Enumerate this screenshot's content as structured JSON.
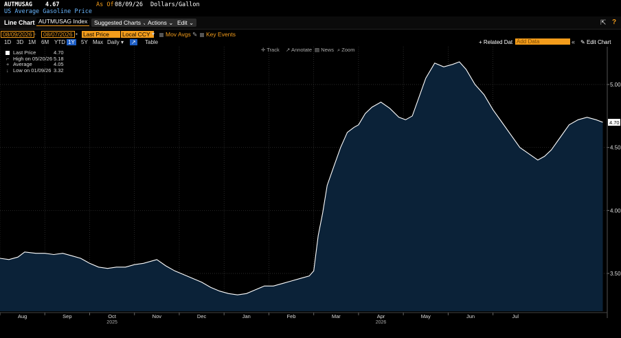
{
  "header": {
    "ticker": "AUTMUSAG",
    "price": "4.67",
    "asof_label": "As Of",
    "asof_date": "08/09/26",
    "units": "Dollars/Gallon",
    "name": "US Average Gasoline Price"
  },
  "toolbar": {
    "chart_type": "Line Chart",
    "security": "AUTMUSAG Index",
    "suggested": "Suggested Charts",
    "actions": "Actions",
    "edit": "Edit"
  },
  "controls": {
    "start_date": "08/09/2026",
    "end_date": "08/07/2026",
    "field": "Last Price",
    "currency": "Local CCY",
    "mov_avgs": "Mov Avgs",
    "key_events": "Key Events",
    "ranges": [
      "1D",
      "3D",
      "1M",
      "6M",
      "YTD",
      "1Y",
      "5Y",
      "Max"
    ],
    "selected_range": "1Y",
    "frequency": "Daily",
    "table": "Table",
    "related": "+ Related Dat",
    "add_data": "Add Data",
    "edit_chart": "Edit Chart"
  },
  "tools": {
    "track": "Track",
    "annotate": "Annotate",
    "news": "News",
    "zoom": "Zoom"
  },
  "legend": [
    {
      "label": "Last Price",
      "value": "4.70"
    },
    {
      "label": "High on 05/20/26",
      "value": "5.18"
    },
    {
      "label": "Average",
      "value": "4.05"
    },
    {
      "label": "Low on 01/09/26",
      "value": "3.32"
    }
  ],
  "chart_data": {
    "type": "area",
    "title": "US Average Gasoline Price",
    "ylabel": "Dollars/Gallon",
    "ylim": [
      3.2,
      5.3
    ],
    "yticks": [
      3.5,
      4.0,
      4.5,
      5.0
    ],
    "ytick_labels": [
      "3.50",
      "4.00",
      "4.50",
      "5.00"
    ],
    "last_value_label": "4.70",
    "months": [
      "Aug",
      "Sep",
      "Oct",
      "Nov",
      "Dec",
      "Jan",
      "Feb",
      "Mar",
      "Apr",
      "May",
      "Jun",
      "Jul"
    ],
    "year_markers": [
      "2025",
      "2026"
    ],
    "x_unit": "months since start of Aug 2025",
    "series": [
      {
        "name": "Last Price",
        "color": "#ffffff",
        "fill": "#0b2238",
        "points": [
          [
            0.0,
            3.62
          ],
          [
            0.2,
            3.61
          ],
          [
            0.4,
            3.63
          ],
          [
            0.55,
            3.67
          ],
          [
            0.8,
            3.66
          ],
          [
            1.0,
            3.66
          ],
          [
            1.2,
            3.65
          ],
          [
            1.4,
            3.66
          ],
          [
            1.6,
            3.64
          ],
          [
            1.8,
            3.62
          ],
          [
            2.0,
            3.58
          ],
          [
            2.2,
            3.55
          ],
          [
            2.4,
            3.54
          ],
          [
            2.6,
            3.55
          ],
          [
            2.8,
            3.55
          ],
          [
            3.0,
            3.57
          ],
          [
            3.2,
            3.58
          ],
          [
            3.4,
            3.6
          ],
          [
            3.5,
            3.61
          ],
          [
            3.7,
            3.56
          ],
          [
            3.9,
            3.52
          ],
          [
            4.1,
            3.49
          ],
          [
            4.3,
            3.46
          ],
          [
            4.5,
            3.43
          ],
          [
            4.7,
            3.39
          ],
          [
            4.9,
            3.36
          ],
          [
            5.1,
            3.34
          ],
          [
            5.3,
            3.33
          ],
          [
            5.5,
            3.34
          ],
          [
            5.7,
            3.37
          ],
          [
            5.9,
            3.4
          ],
          [
            6.1,
            3.4
          ],
          [
            6.3,
            3.42
          ],
          [
            6.5,
            3.44
          ],
          [
            6.7,
            3.46
          ],
          [
            6.9,
            3.48
          ],
          [
            7.0,
            3.52
          ],
          [
            7.1,
            3.8
          ],
          [
            7.2,
            3.98
          ],
          [
            7.3,
            4.2
          ],
          [
            7.45,
            4.35
          ],
          [
            7.6,
            4.5
          ],
          [
            7.75,
            4.62
          ],
          [
            7.9,
            4.66
          ],
          [
            8.0,
            4.68
          ],
          [
            8.15,
            4.77
          ],
          [
            8.3,
            4.82
          ],
          [
            8.5,
            4.86
          ],
          [
            8.7,
            4.81
          ],
          [
            8.9,
            4.74
          ],
          [
            9.05,
            4.72
          ],
          [
            9.2,
            4.75
          ],
          [
            9.35,
            4.9
          ],
          [
            9.5,
            5.05
          ],
          [
            9.7,
            5.17
          ],
          [
            9.9,
            5.14
          ],
          [
            10.1,
            5.16
          ],
          [
            10.25,
            5.18
          ],
          [
            10.4,
            5.12
          ],
          [
            10.6,
            5.0
          ],
          [
            10.8,
            4.92
          ],
          [
            11.0,
            4.8
          ],
          [
            11.2,
            4.7
          ],
          [
            11.4,
            4.6
          ],
          [
            11.6,
            4.5
          ],
          [
            11.8,
            4.45
          ],
          [
            12.0,
            4.4
          ],
          [
            12.15,
            4.43
          ],
          [
            12.3,
            4.48
          ],
          [
            12.5,
            4.58
          ],
          [
            12.7,
            4.68
          ],
          [
            12.9,
            4.72
          ],
          [
            13.1,
            4.74
          ],
          [
            13.3,
            4.72
          ],
          [
            13.45,
            4.7
          ]
        ]
      }
    ]
  },
  "icons": {
    "export": "export-icon",
    "help": "help-icon",
    "pencil": "pencil-icon",
    "collapse": "double-chevron-icon"
  }
}
